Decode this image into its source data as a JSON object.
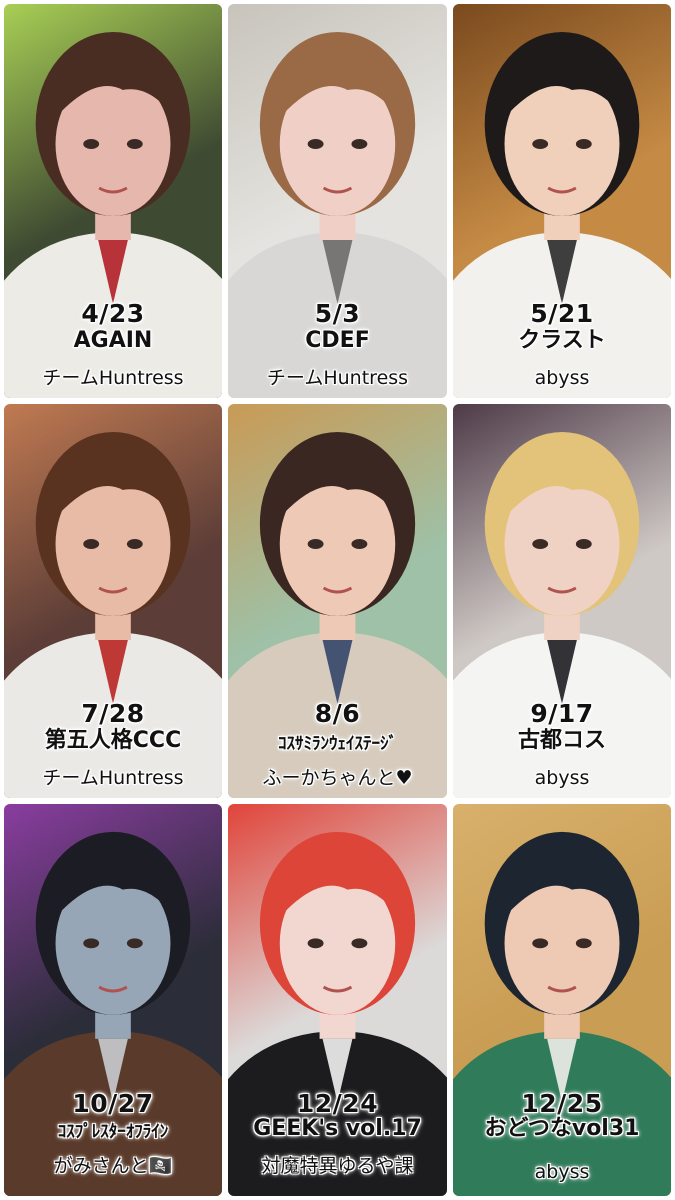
{
  "tiles": [
    {
      "date": "4/23",
      "event": "AGAIN",
      "group": "チームHuntress",
      "colors": {
        "bg": "#3f4a32",
        "accent": "#a8cf55",
        "skin": "#e6b8ad",
        "hair": "#4a2d22",
        "cloth": "#ecebe6",
        "tie": "#b21e26"
      }
    },
    {
      "date": "5/3",
      "event": "CDEF",
      "group": "チームHuntress",
      "colors": {
        "bg": "#e4e3df",
        "accent": "#c8c4bc",
        "skin": "#f0d0c6",
        "hair": "#9a6a47",
        "cloth": "#d8d7d6",
        "tie": "#6e6a6a"
      }
    },
    {
      "date": "5/21",
      "event": "クラスト",
      "group": "abyss",
      "colors": {
        "bg": "#c58a44",
        "accent": "#7a4a1e",
        "skin": "#f1d0bb",
        "hair": "#1e1a1a",
        "cloth": "#f2f1ee",
        "tie": "#2a2a2a"
      }
    },
    {
      "date": "7/28",
      "event": "第五人格CCC",
      "group": "チームHuntress",
      "colors": {
        "bg": "#5c3d37",
        "accent": "#c07a52",
        "skin": "#e7bba5",
        "hair": "#5a3320",
        "cloth": "#ebe9e6",
        "tie": "#b92522"
      }
    },
    {
      "date": "8/6",
      "event": "ｺｽｻﾐﾗﾝｳｪｲｽﾃｰｼﾞ",
      "group": "ふーかちゃんと♥",
      "colors": {
        "bg": "#9ec1a7",
        "accent": "#c99a55",
        "skin": "#eec9b6",
        "hair": "#3a2722",
        "cloth": "#d6cbbd",
        "tie": "#35466a"
      }
    },
    {
      "date": "9/17",
      "event": "古都コス",
      "group": "abyss",
      "colors": {
        "bg": "#cfc9c5",
        "accent": "#4e3a48",
        "skin": "#efd2c3",
        "hair": "#e3c27a",
        "cloth": "#f4f4f2",
        "tie": "#1d1d22"
      }
    },
    {
      "date": "10/27",
      "event": "ｺｽﾌﾟﾚｽﾀｰｵﾌﾗｲﾝ",
      "group": "がみさんと🏴‍☠️",
      "colors": {
        "bg": "#2b2d38",
        "accent": "#8a3da0",
        "skin": "#96a6b6",
        "hair": "#1c1c24",
        "cloth": "#5a3a2a",
        "tie": "#c9cdd2"
      }
    },
    {
      "date": "12/24",
      "event": "GEEK's vol.17",
      "group": "対魔特異ゆるや課",
      "colors": {
        "bg": "#dcdad9",
        "accent": "#e0443a",
        "skin": "#f1d7d0",
        "hair": "#dd4538",
        "cloth": "#1c1c1e",
        "tie": "#f2f2f2"
      }
    },
    {
      "date": "12/25",
      "event": "おどつなvol31",
      "group": "abyss",
      "colors": {
        "bg": "#c99d53",
        "accent": "#d8b06c",
        "skin": "#eec9b3",
        "hair": "#1c2530",
        "cloth": "#2f7b5a",
        "tie": "#efeeea"
      }
    }
  ]
}
